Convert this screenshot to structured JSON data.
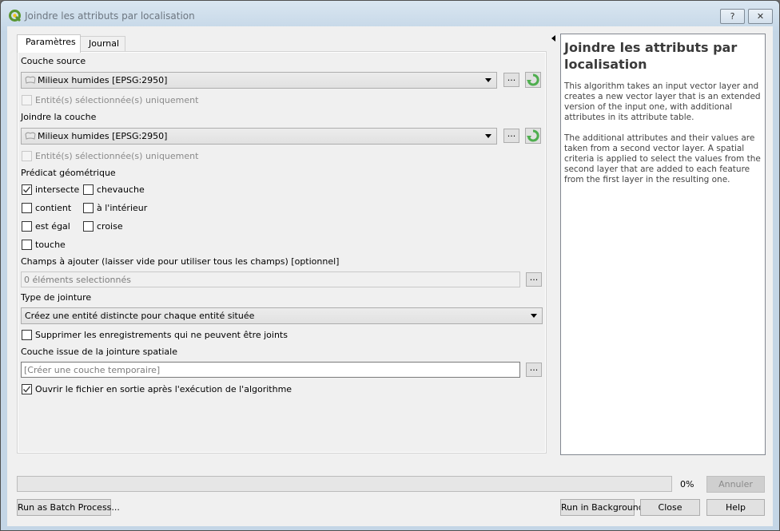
{
  "window": {
    "title": "Joindre les attributs par localisation",
    "help_button": "?",
    "close_button": "✕"
  },
  "tabs": [
    {
      "label": "Paramètres",
      "active": true
    },
    {
      "label": "Journal",
      "active": false
    }
  ],
  "params": {
    "source_layer": {
      "label": "Couche source",
      "value": "Milieux humides [EPSG:2950]",
      "browse_label": "...",
      "selected_only_label": "Entité(s) sélectionnée(s) uniquement",
      "selected_only_checked": false
    },
    "join_layer": {
      "label": "Joindre la couche",
      "value": "Milieux humides [EPSG:2950]",
      "browse_label": "...",
      "selected_only_label": "Entité(s) sélectionnée(s) uniquement",
      "selected_only_checked": false
    },
    "predicate": {
      "label": "Prédicat géométrique",
      "options": [
        {
          "label": "intersecte",
          "checked": true
        },
        {
          "label": "chevauche",
          "checked": false
        },
        {
          "label": "contient",
          "checked": false
        },
        {
          "label": "à l'intérieur",
          "checked": false
        },
        {
          "label": "est égal",
          "checked": false
        },
        {
          "label": "croise",
          "checked": false
        },
        {
          "label": "touche",
          "checked": false
        }
      ]
    },
    "fields": {
      "label": "Champs à ajouter (laisser vide pour utiliser tous les champs) [optionnel]",
      "value": "0 éléments selectionnés",
      "browse_label": "..."
    },
    "join_type": {
      "label": "Type de jointure",
      "value": "Créez une entité distincte pour chaque entité située"
    },
    "discard": {
      "label": "Supprimer les enregistrements qui ne peuvent être joints",
      "checked": false
    },
    "output": {
      "label": "Couche issue de la jointure spatiale",
      "placeholder": "[Créer une couche temporaire]",
      "browse_label": "..."
    },
    "open_output": {
      "label": "Ouvrir le fichier en sortie après l'exécution de l'algorithme",
      "checked": true
    }
  },
  "help": {
    "title": "Joindre les attributs par localisation",
    "paragraphs": [
      "This algorithm takes an input vector layer and creates a new vector layer that is an extended version of the input one, with additional attributes in its attribute table.",
      "The additional attributes and their values are taken from a second vector layer. A spatial criteria is applied to select the values from the second layer that are added to each feature from the first layer in the resulting one."
    ]
  },
  "progress": {
    "percent": 0,
    "label": "0%",
    "cancel_label": "Annuler"
  },
  "footer": {
    "batch_label": "Run as Batch Process...",
    "background_label": "Run in Background",
    "close_label": "Close",
    "help_label": "Help"
  },
  "colors": {
    "qgis_green": "#589632",
    "qgis_yellow": "#f0c419",
    "progress_fill": "#06b025"
  }
}
